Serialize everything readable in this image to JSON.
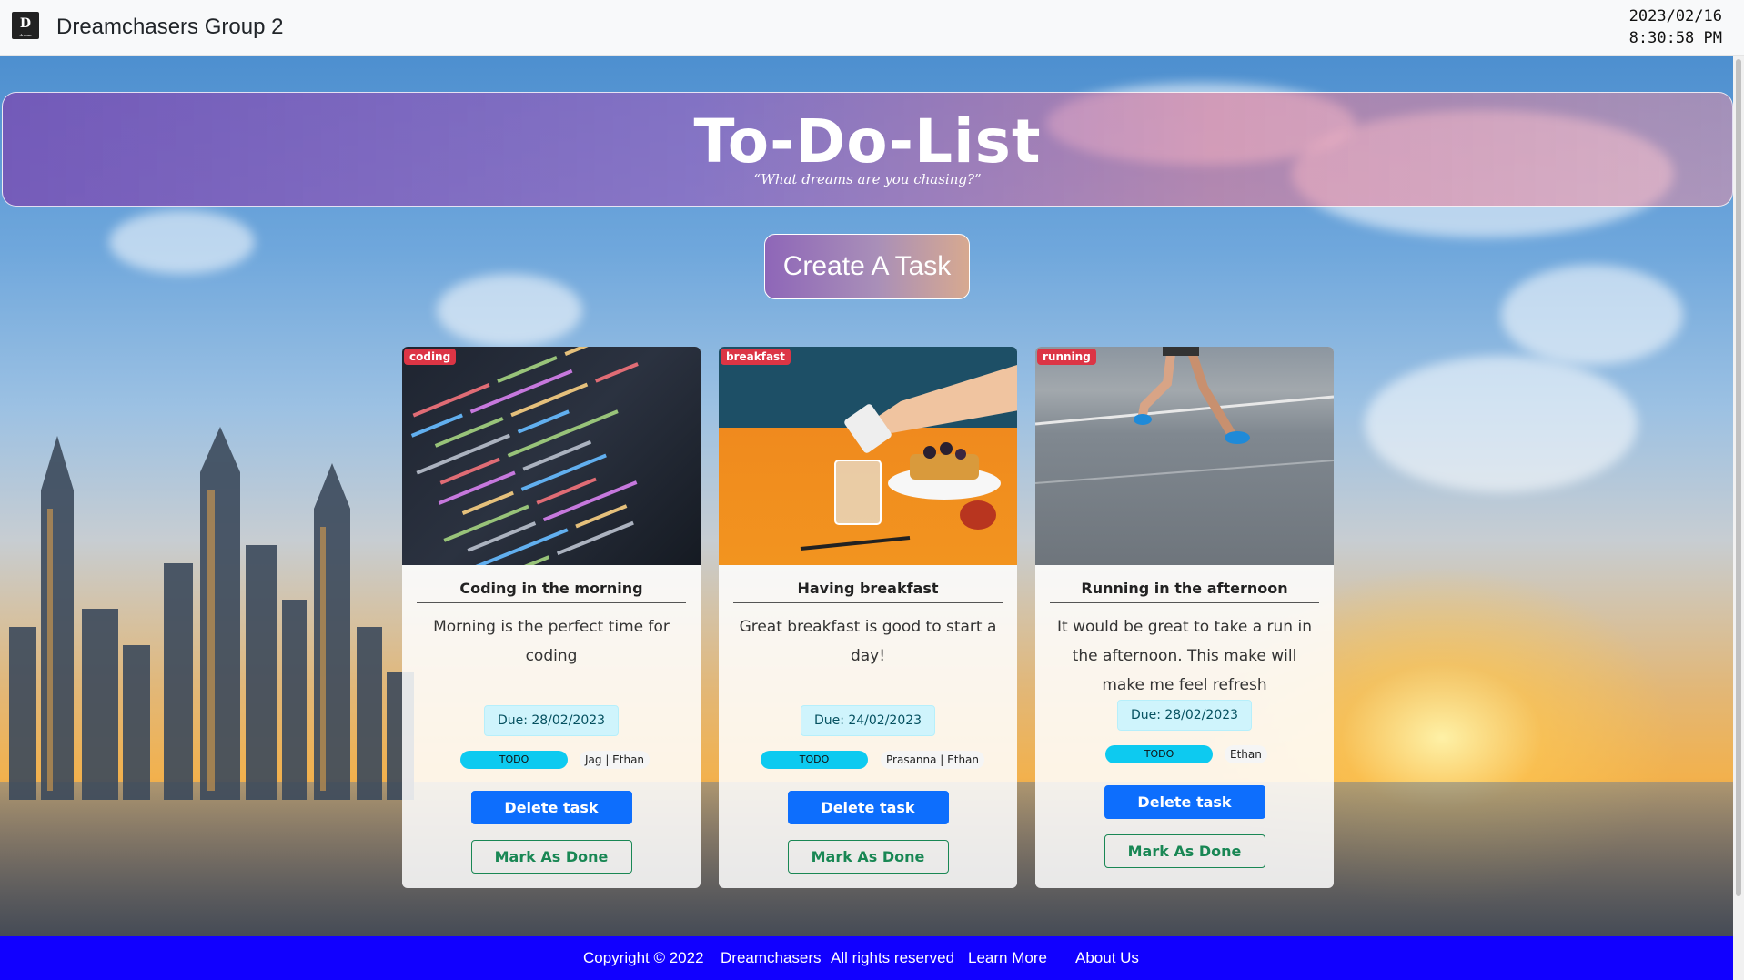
{
  "navbar": {
    "brand_logo_text": "D",
    "brand_logo_subtext": "dream",
    "brand_name": "Dreamchasers Group 2",
    "date": "2023/02/16",
    "time": "8:30:58 PM"
  },
  "banner": {
    "title": "To-Do-List",
    "tagline": "“What dreams are you chasing?”"
  },
  "create_button": {
    "label": "Create A Task"
  },
  "cards": [
    {
      "category": "coding",
      "title": "Coding in the morning",
      "description": "Morning is the perfect time for coding",
      "due": "Due: 28/02/2023",
      "status": "TODO",
      "assignees": "Jag | Ethan",
      "delete_label": "Delete task",
      "done_label": "Mark As Done",
      "image_icon": "code-screen-image"
    },
    {
      "category": "breakfast",
      "title": "Having breakfast",
      "description": "Great breakfast is good to start a day!",
      "due": "Due: 24/02/2023",
      "status": "TODO",
      "assignees": "Prasanna | Ethan",
      "delete_label": "Delete task",
      "done_label": "Mark As Done",
      "image_icon": "breakfast-image"
    },
    {
      "category": "running",
      "title": "Running in the afternoon",
      "description": "It would be great to take a run in the afternoon. This make will make me feel refresh",
      "due": "Due: 28/02/2023",
      "status": "TODO",
      "assignees": "Ethan",
      "delete_label": "Delete task",
      "done_label": "Mark As Done",
      "image_icon": "running-image"
    }
  ],
  "footer": {
    "copyright": "Copyright © 2022",
    "company": "Dreamchasers",
    "rights": "All rights reserved",
    "learn_more": "Learn More",
    "about_us": "About Us"
  },
  "colors": {
    "footer_bg": "#1100ff",
    "delete_button": "#0d6efd",
    "done_button": "#198754",
    "category_badge": "#dc3545",
    "status_badge": "#0dcaf0",
    "due_badge": "#cff4fc"
  }
}
